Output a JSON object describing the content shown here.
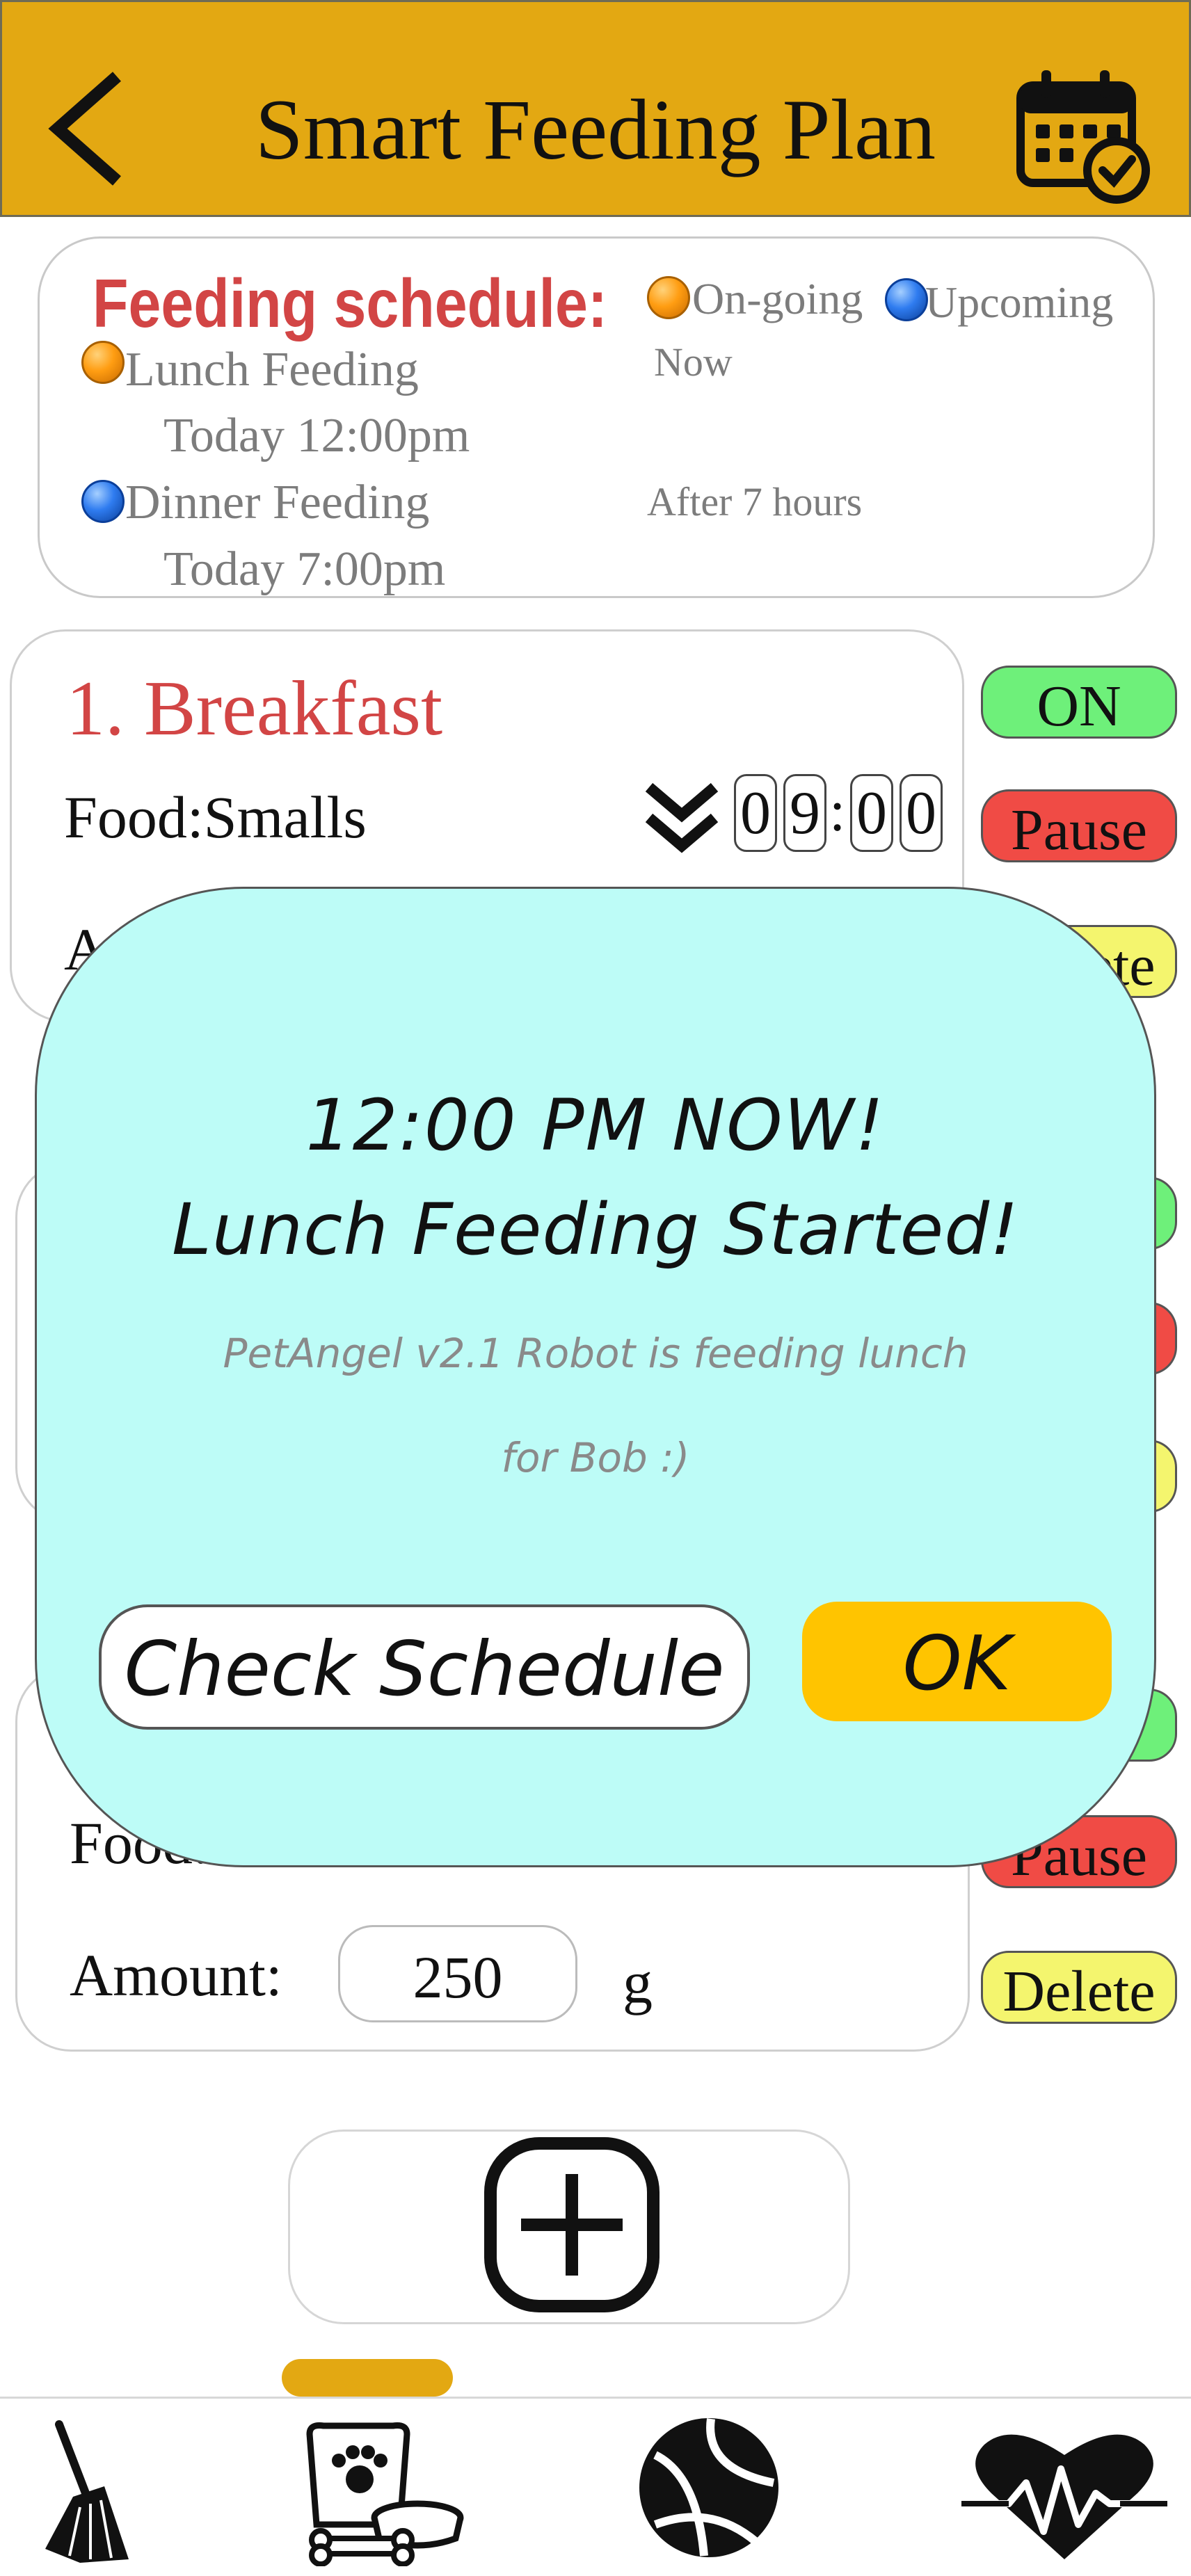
{
  "header": {
    "title": "Smart Feeding Plan",
    "back_icon": "chevron-left-icon",
    "calendar_icon": "calendar-check-icon",
    "background": "#e3a812"
  },
  "schedule": {
    "title": "Feeding schedule:",
    "legend_ongoing": "On-going",
    "legend_upcoming": "Upcoming",
    "items": [
      {
        "name": "Lunch Feeding",
        "time": "Today 12:00pm",
        "status": "Now",
        "state": "ongoing"
      },
      {
        "name": "Dinner Feeding",
        "time": "Today 7:00pm",
        "status": "After 7 hours",
        "state": "upcoming"
      }
    ]
  },
  "meals": [
    {
      "title": "1. Breakfast",
      "food_label": "Food:Smalls",
      "time_digits": [
        "0",
        "9",
        "0",
        "0"
      ],
      "time_sep": ":",
      "amount_label": "Amount:"
    },
    {
      "food_label": "Food:",
      "amount_label": "Amount:",
      "amount_value": "250",
      "amount_unit": "g"
    }
  ],
  "controls": {
    "on": "ON",
    "pause": "Pause",
    "delete": "Delete"
  },
  "colors": {
    "on": "#6ef07a",
    "pause": "#f04b45",
    "delete": "#f4f56e",
    "schedule_title": "#d24545"
  },
  "modal": {
    "line1": "12:00 PM NOW!",
    "line2": "Lunch Feeding Started!",
    "body_line1": "PetAngel v2.1 Robot is feeding lunch",
    "body_line2": "for Bob :)",
    "check_button": "Check Schedule",
    "ok_button": "OK",
    "background": "#bdfcf7",
    "ok_color": "#ffc400"
  },
  "add_icon": "plus-square-icon",
  "nav": [
    {
      "icon": "broom-icon"
    },
    {
      "icon": "pet-food-icon",
      "active": true
    },
    {
      "icon": "ball-icon"
    },
    {
      "icon": "heartbeat-icon"
    }
  ]
}
